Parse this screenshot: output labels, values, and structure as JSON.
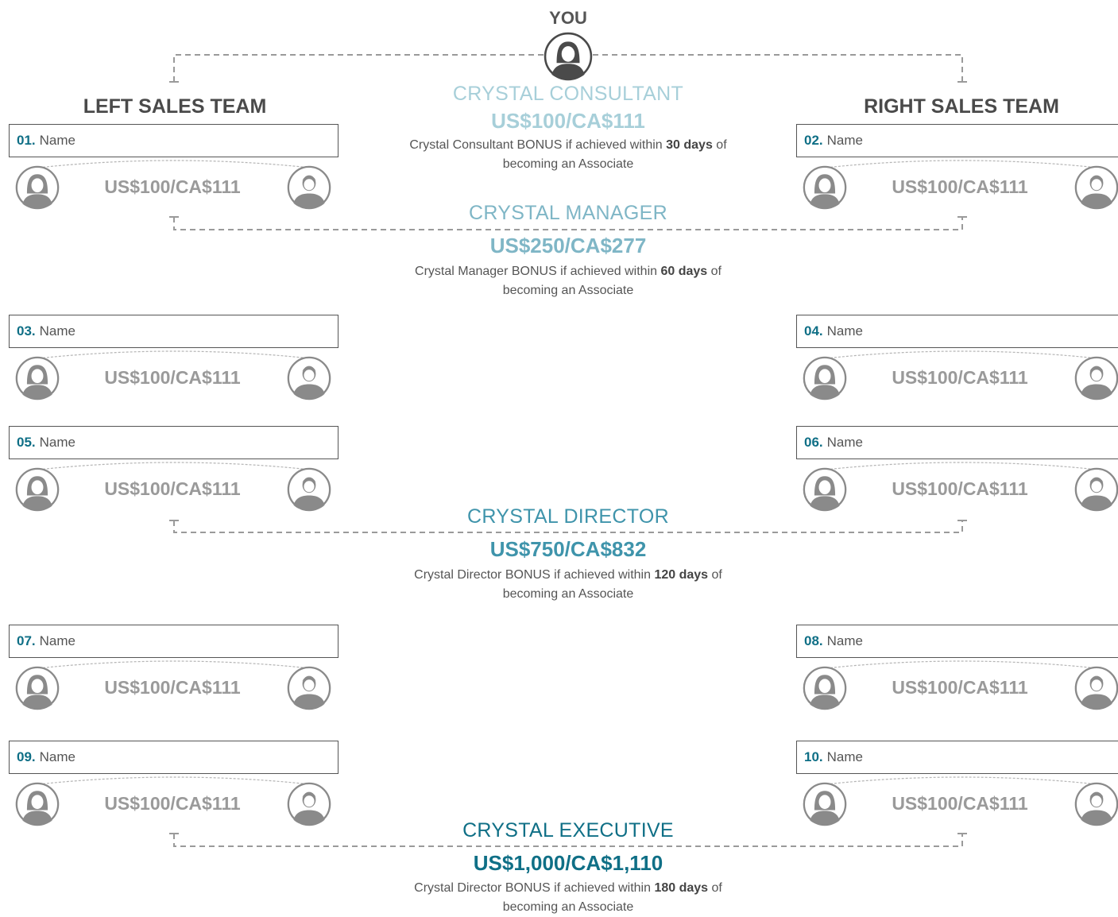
{
  "header": {
    "you_label": "YOU"
  },
  "teams": {
    "left_title": "LEFT SALES TEAM",
    "right_title": "RIGHT SALES TEAM"
  },
  "ranks": [
    {
      "title": "CRYSTAL CONSULTANT",
      "amount": "US$100/CA$111",
      "color": "#a7cfd9",
      "desc_pre": "Crystal Consultant BONUS if achieved within ",
      "desc_bold": "30 days",
      "desc_post": " of becoming an Associate"
    },
    {
      "title": "CRYSTAL MANAGER",
      "amount": "US$250/CA$277",
      "color": "#7fb6c6",
      "desc_pre": "Crystal Manager BONUS if achieved within ",
      "desc_bold": "60 days",
      "desc_post": " of becoming an Associate"
    },
    {
      "title": "CRYSTAL DIRECTOR",
      "amount": "US$750/CA$832",
      "color": "#3f94ab",
      "desc_pre": "Crystal Director BONUS if achieved within ",
      "desc_bold": "120 days",
      "desc_post": " of becoming an Associate"
    },
    {
      "title": "CRYSTAL EXECUTIVE",
      "amount": "US$1,000/CA$1,110",
      "color": "#0f6f86",
      "desc_pre": "Crystal Director BONUS if achieved within ",
      "desc_bold": "180 days",
      "desc_post": " of becoming an Associate"
    }
  ],
  "members": [
    {
      "num": "01.",
      "name": "Name",
      "amount": "US$100/CA$111"
    },
    {
      "num": "02.",
      "name": "Name",
      "amount": "US$100/CA$111"
    },
    {
      "num": "03.",
      "name": "Name",
      "amount": "US$100/CA$111"
    },
    {
      "num": "04.",
      "name": "Name",
      "amount": "US$100/CA$111"
    },
    {
      "num": "05.",
      "name": "Name",
      "amount": "US$100/CA$111"
    },
    {
      "num": "06.",
      "name": "Name",
      "amount": "US$100/CA$111"
    },
    {
      "num": "07.",
      "name": "Name",
      "amount": "US$100/CA$111"
    },
    {
      "num": "08.",
      "name": "Name",
      "amount": "US$100/CA$111"
    },
    {
      "num": "09.",
      "name": "Name",
      "amount": "US$100/CA$111"
    },
    {
      "num": "10.",
      "name": "Name",
      "amount": "US$100/CA$111"
    }
  ],
  "colors": {
    "accent": "#0f6f86",
    "line": "#9a9a9a",
    "avatar": "#8a8a8a"
  },
  "icons": {
    "you": "woman-avatar-icon",
    "female": "woman-avatar-icon",
    "male": "man-avatar-icon"
  }
}
